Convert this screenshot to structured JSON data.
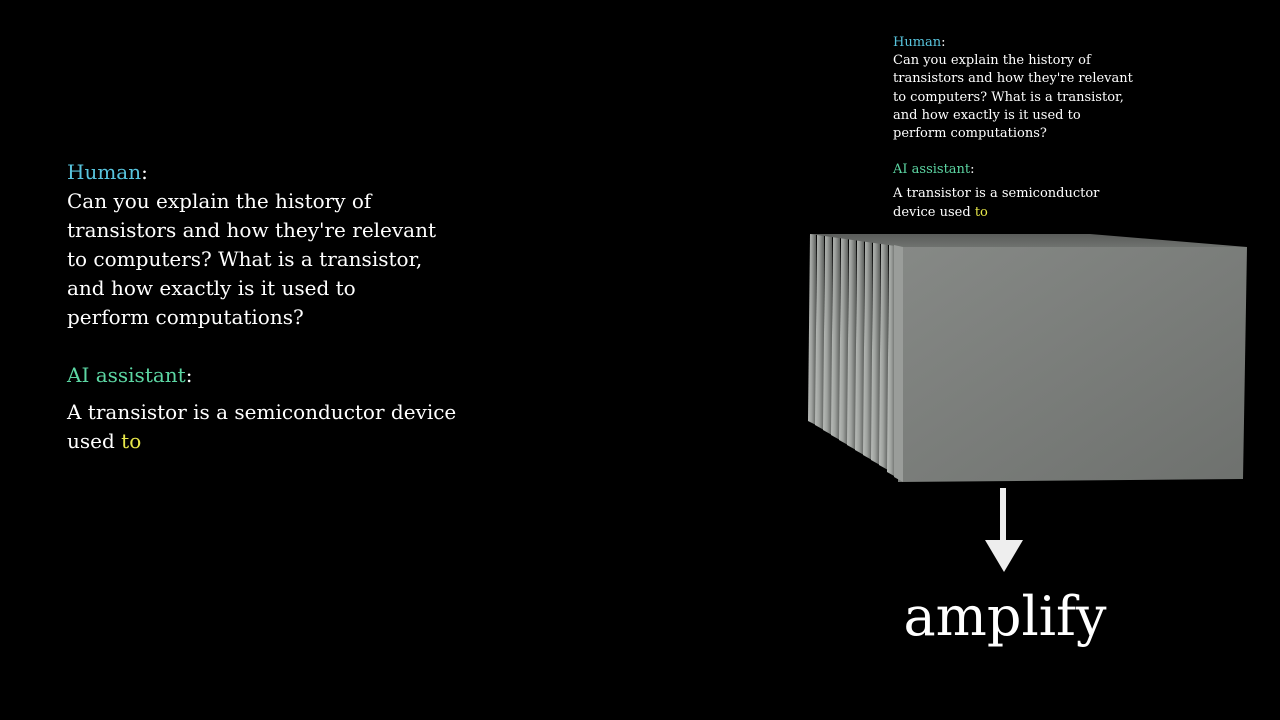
{
  "left_conversation": {
    "human_label": "Human",
    "colon": ":",
    "human_lines": [
      "Can you explain the history of",
      "transistors and how they're relevant",
      "to computers? What is a transistor,",
      "and how exactly is it used to",
      "perform computations?"
    ],
    "ai_label": "AI assistant",
    "ai_text": "A transistor is a semiconductor device used",
    "ai_next_token": "to"
  },
  "right_conversation": {
    "human_label": "Human",
    "colon": ":",
    "human_lines": [
      "Can you explain the history of",
      "transistors and how they're relevant",
      "to computers? What is a transistor,",
      "and how exactly is it used to",
      "perform computations?"
    ],
    "ai_label": "AI assistant",
    "ai_text": "A transistor is a semiconductor device used",
    "ai_next_token": "to"
  },
  "output": {
    "predicted_word": "amplify"
  },
  "colors": {
    "background": "#000000",
    "human_label": "#58c4dd",
    "ai_label": "#5cd6a3",
    "highlight_token": "#e8e84a",
    "text": "#ffffff",
    "block_face": "#7a7d7b"
  },
  "icons": {
    "arrow": "arrow-down-icon"
  }
}
